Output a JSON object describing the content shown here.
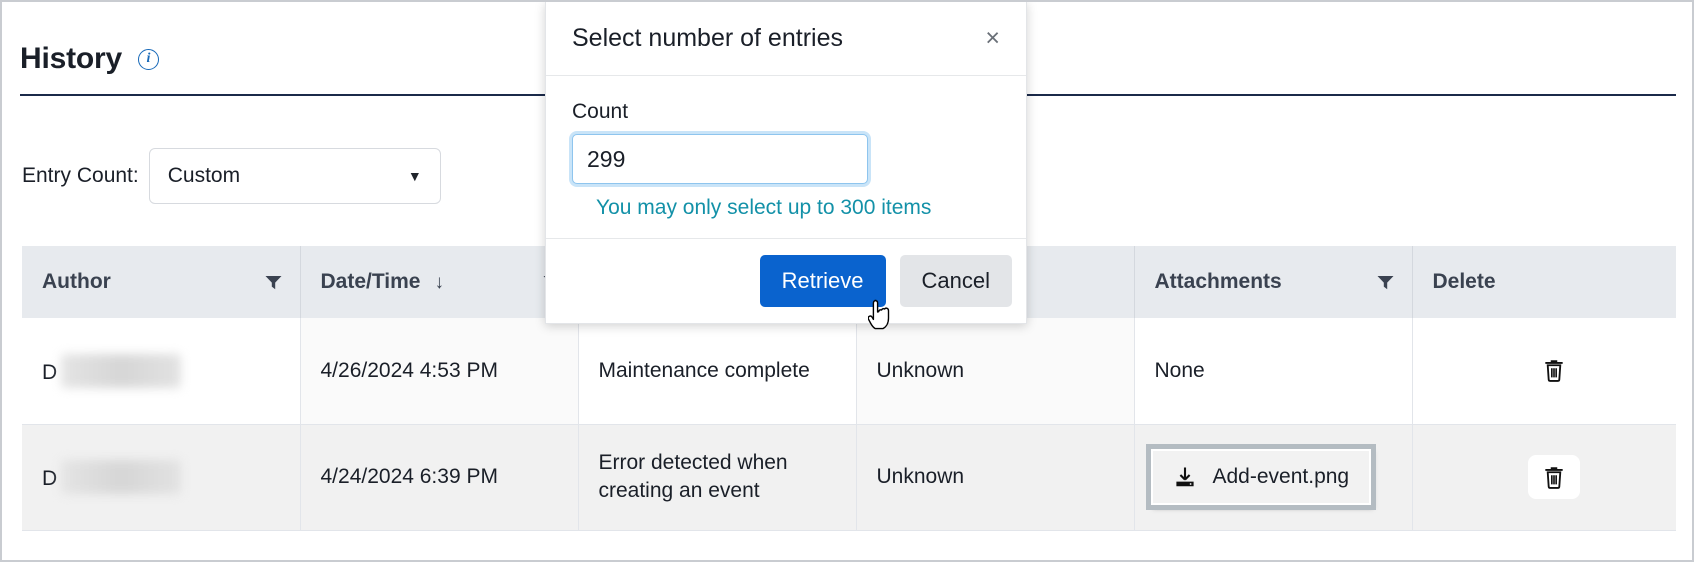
{
  "header": {
    "title": "History",
    "info_icon": "info-icon"
  },
  "entry_count": {
    "label": "Entry Count:",
    "selected": "Custom",
    "caret": "▼"
  },
  "table": {
    "columns": [
      {
        "label": "Author",
        "filter": true,
        "sort": null
      },
      {
        "label": "Date/Time",
        "filter": true,
        "sort": "↓"
      },
      {
        "label": "",
        "filter": false,
        "sort": null
      },
      {
        "label": "",
        "filter": false,
        "sort": null
      },
      {
        "label": "Attachments",
        "filter": true,
        "sort": null
      },
      {
        "label": "Delete",
        "filter": false,
        "sort": null
      }
    ],
    "rows": [
      {
        "author_prefix": "D",
        "author_redacted": true,
        "datetime": "4/26/2024 4:53 PM",
        "description": "Maintenance complete",
        "status": "Unknown",
        "attachment": "None",
        "attachment_highlighted": false,
        "delete_icon": "trash-icon"
      },
      {
        "author_prefix": "D",
        "author_redacted": true,
        "datetime": "4/24/2024 6:39 PM",
        "description": "Error detected when creating an event",
        "status": "Unknown",
        "attachment": "Add-event.png",
        "attachment_highlighted": true,
        "delete_icon": "trash-icon"
      }
    ]
  },
  "modal": {
    "title": "Select number of entries",
    "close_label": "×",
    "count_label": "Count",
    "count_value": "299",
    "count_placeholder": "",
    "spin_up": "▲",
    "spin_down": "▼",
    "hint": "You may only select up to 300 items",
    "retrieve_label": "Retrieve",
    "cancel_label": "Cancel"
  },
  "colors": {
    "primary": "#0a63ce",
    "hint": "#1391a8",
    "header_underline": "#1b2a4a",
    "table_header_bg": "#e7eaee",
    "focus_ring": "#c9e4f8"
  }
}
